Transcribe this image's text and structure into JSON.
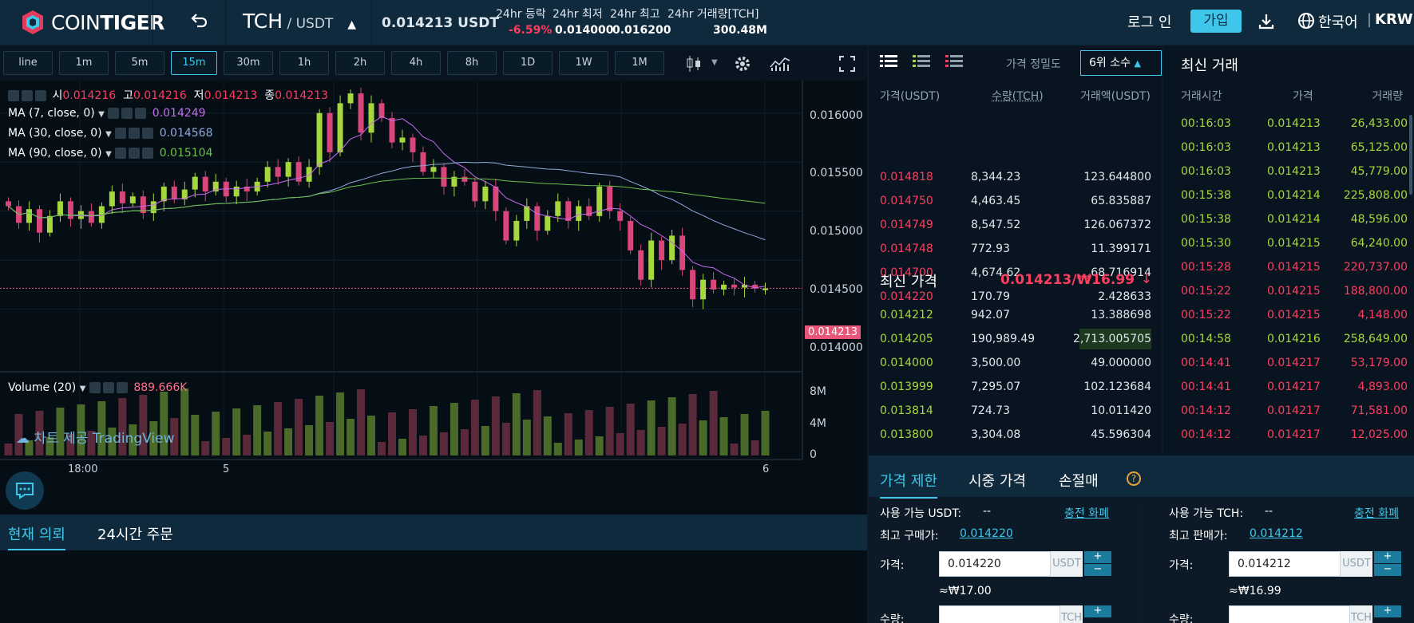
{
  "header": {
    "logo_text_a": "COIN",
    "logo_text_b": "TIGER",
    "pair_base": "TCH",
    "pair_sep": " / ",
    "pair_quote": "USDT",
    "last_price": "0.014213 USDT",
    "stats": [
      {
        "label": "24hr 등락",
        "value": "-6.59%"
      },
      {
        "label": "24hr 최저",
        "value": "0.014000"
      },
      {
        "label": "24hr 최고",
        "value": "0.016200"
      },
      {
        "label": "24hr 거래량[TCH]",
        "value": "300.48M"
      }
    ],
    "login": "로그 인",
    "signup": "가입",
    "language": "한국어",
    "currency": "KRW"
  },
  "timeframes": [
    "line",
    "1m",
    "5m",
    "15m",
    "30m",
    "1h",
    "2h",
    "4h",
    "8h",
    "1D",
    "1W",
    "1M"
  ],
  "active_timeframe": "15m",
  "chart": {
    "ohlc": {
      "o_label": "시",
      "o": "0.014216",
      "h_label": "고",
      "h": "0.014216",
      "l_label": "저",
      "l": "0.014213",
      "c_label": "종",
      "c": "0.014213"
    },
    "ma7": {
      "label": "MA (7, close, 0)",
      "value": "0.014249",
      "color": "#c56cf0"
    },
    "ma30": {
      "label": "MA (30, close, 0)",
      "value": "0.014568",
      "color": "#8fa9d9"
    },
    "ma90": {
      "label": "MA (90, close, 0)",
      "value": "0.015104",
      "color": "#6cc04a"
    },
    "price_ticks": [
      "0.016000",
      "0.015500",
      "0.015000",
      "0.014500",
      "0.014000"
    ],
    "current_price_tag": "0.014213",
    "volume": {
      "label": "Volume (20)",
      "value": "889.666K",
      "ticks": [
        "8M",
        "4M",
        "0"
      ]
    },
    "time_ticks": [
      "18:00",
      "5",
      "6"
    ],
    "watermark": "차트 제공 TradingView"
  },
  "orders_tabs": [
    "현재 의뢰",
    "24시간 주문"
  ],
  "orderbook": {
    "precision_label": "가격 정밀도",
    "precision_value": "6위 소수",
    "headers": {
      "price": "가격(USDT)",
      "qty": "수량(TCH)",
      "total": "거래액(USDT)"
    },
    "asks": [
      {
        "price": "0.014818",
        "qty": "8,344.23",
        "total": "123.644800"
      },
      {
        "price": "0.014750",
        "qty": "4,463.45",
        "total": "65.835887"
      },
      {
        "price": "0.014749",
        "qty": "8,547.52",
        "total": "126.067372"
      },
      {
        "price": "0.014748",
        "qty": "772.93",
        "total": "11.399171"
      },
      {
        "price": "0.014700",
        "qty": "4,674.62",
        "total": "68.716914"
      },
      {
        "price": "0.014220",
        "qty": "170.79",
        "total": "2.428633"
      }
    ],
    "latest_label": "최신 가격",
    "latest_value": "0.014213/₩16.99",
    "latest_arrow": "↓",
    "bids": [
      {
        "price": "0.014212",
        "qty": "942.07",
        "total": "13.388698"
      },
      {
        "price": "0.014205",
        "qty": "190,989.49",
        "total": "2,713.005705"
      },
      {
        "price": "0.014000",
        "qty": "3,500.00",
        "total": "49.000000"
      },
      {
        "price": "0.013999",
        "qty": "7,295.07",
        "total": "102.123684"
      },
      {
        "price": "0.013814",
        "qty": "724.73",
        "total": "10.011420"
      },
      {
        "price": "0.013800",
        "qty": "3,304.08",
        "total": "45.596304"
      }
    ]
  },
  "trades": {
    "title": "최신 거래",
    "headers": {
      "time": "거래시간",
      "price": "가격",
      "qty": "거래량"
    },
    "rows": [
      {
        "time": "00:16:03",
        "price": "0.014213",
        "qty": "26,433.00",
        "side": "buy"
      },
      {
        "time": "00:16:03",
        "price": "0.014213",
        "qty": "65,125.00",
        "side": "buy"
      },
      {
        "time": "00:16:03",
        "price": "0.014213",
        "qty": "45,779.00",
        "side": "buy"
      },
      {
        "time": "00:15:38",
        "price": "0.014214",
        "qty": "225,808.00",
        "side": "buy"
      },
      {
        "time": "00:15:38",
        "price": "0.014214",
        "qty": "48,596.00",
        "side": "buy"
      },
      {
        "time": "00:15:30",
        "price": "0.014215",
        "qty": "64,240.00",
        "side": "buy"
      },
      {
        "time": "00:15:28",
        "price": "0.014215",
        "qty": "220,737.00",
        "side": "sell"
      },
      {
        "time": "00:15:22",
        "price": "0.014215",
        "qty": "188,800.00",
        "side": "sell"
      },
      {
        "time": "00:15:22",
        "price": "0.014215",
        "qty": "4,148.00",
        "side": "sell"
      },
      {
        "time": "00:14:58",
        "price": "0.014216",
        "qty": "258,649.00",
        "side": "buy"
      },
      {
        "time": "00:14:41",
        "price": "0.014217",
        "qty": "53,179.00",
        "side": "sell"
      },
      {
        "time": "00:14:41",
        "price": "0.014217",
        "qty": "4,893.00",
        "side": "sell"
      },
      {
        "time": "00:14:12",
        "price": "0.014217",
        "qty": "71,581.00",
        "side": "sell"
      },
      {
        "time": "00:14:12",
        "price": "0.014217",
        "qty": "12,025.00",
        "side": "sell"
      }
    ]
  },
  "order_form": {
    "tabs": [
      "가격 제한",
      "시중 가격",
      "손절매"
    ],
    "buy": {
      "available_label": "사용 가능 USDT:",
      "available_value": "--",
      "deposit_link": "충전 화폐",
      "best_label": "최고 구매가:",
      "best_value": "0.014220",
      "price_label": "가격:",
      "price_value": "0.014220",
      "price_unit": "USDT",
      "krw_hint": "≈₩17.00",
      "qty_label": "수량:",
      "qty_unit": "TCH"
    },
    "sell": {
      "available_label": "사용 가능 TCH:",
      "available_value": "--",
      "deposit_link": "충전 화폐",
      "best_label": "최고 판매가:",
      "best_value": "0.014212",
      "price_label": "가격:",
      "price_value": "0.014212",
      "price_unit": "USDT",
      "krw_hint": "≈₩16.99",
      "qty_label": "수량:",
      "qty_unit": "TCH"
    }
  },
  "colors": {
    "up": "#a5d83d",
    "down": "#ff3d5f",
    "accent": "#3ec7ea",
    "volume_up": "#4a6a2a",
    "volume_down": "#5a2a3a"
  },
  "chart_data": {
    "type": "candlestick",
    "y_range": [
      0.01385,
      0.01625
    ],
    "closes": [
      0.01505,
      0.01488,
      0.01502,
      0.01478,
      0.01495,
      0.0151,
      0.01492,
      0.015,
      0.01488,
      0.01505,
      0.0152,
      0.01508,
      0.01515,
      0.01498,
      0.0151,
      0.01525,
      0.01512,
      0.01522,
      0.01535,
      0.0152,
      0.0153,
      0.01515,
      0.01525,
      0.0152,
      0.0153,
      0.01545,
      0.01535,
      0.0155,
      0.0153,
      0.01545,
      0.016,
      0.0156,
      0.0161,
      0.0162,
      0.0158,
      0.0161,
      0.01595,
      0.0157,
      0.01575,
      0.0156,
      0.0154,
      0.01545,
      0.01525,
      0.01535,
      0.0153,
      0.0151,
      0.01525,
      0.015,
      0.0147,
      0.0149,
      0.01505,
      0.0148,
      0.01495,
      0.0151,
      0.0149,
      0.01505,
      0.01495,
      0.01525,
      0.015,
      0.0149,
      0.0146,
      0.0143,
      0.0147,
      0.0145,
      0.01475,
      0.0144,
      0.0141,
      0.0143,
      0.0142,
      0.01425,
      0.01422,
      0.01425,
      0.01421,
      0.01421
    ]
  }
}
